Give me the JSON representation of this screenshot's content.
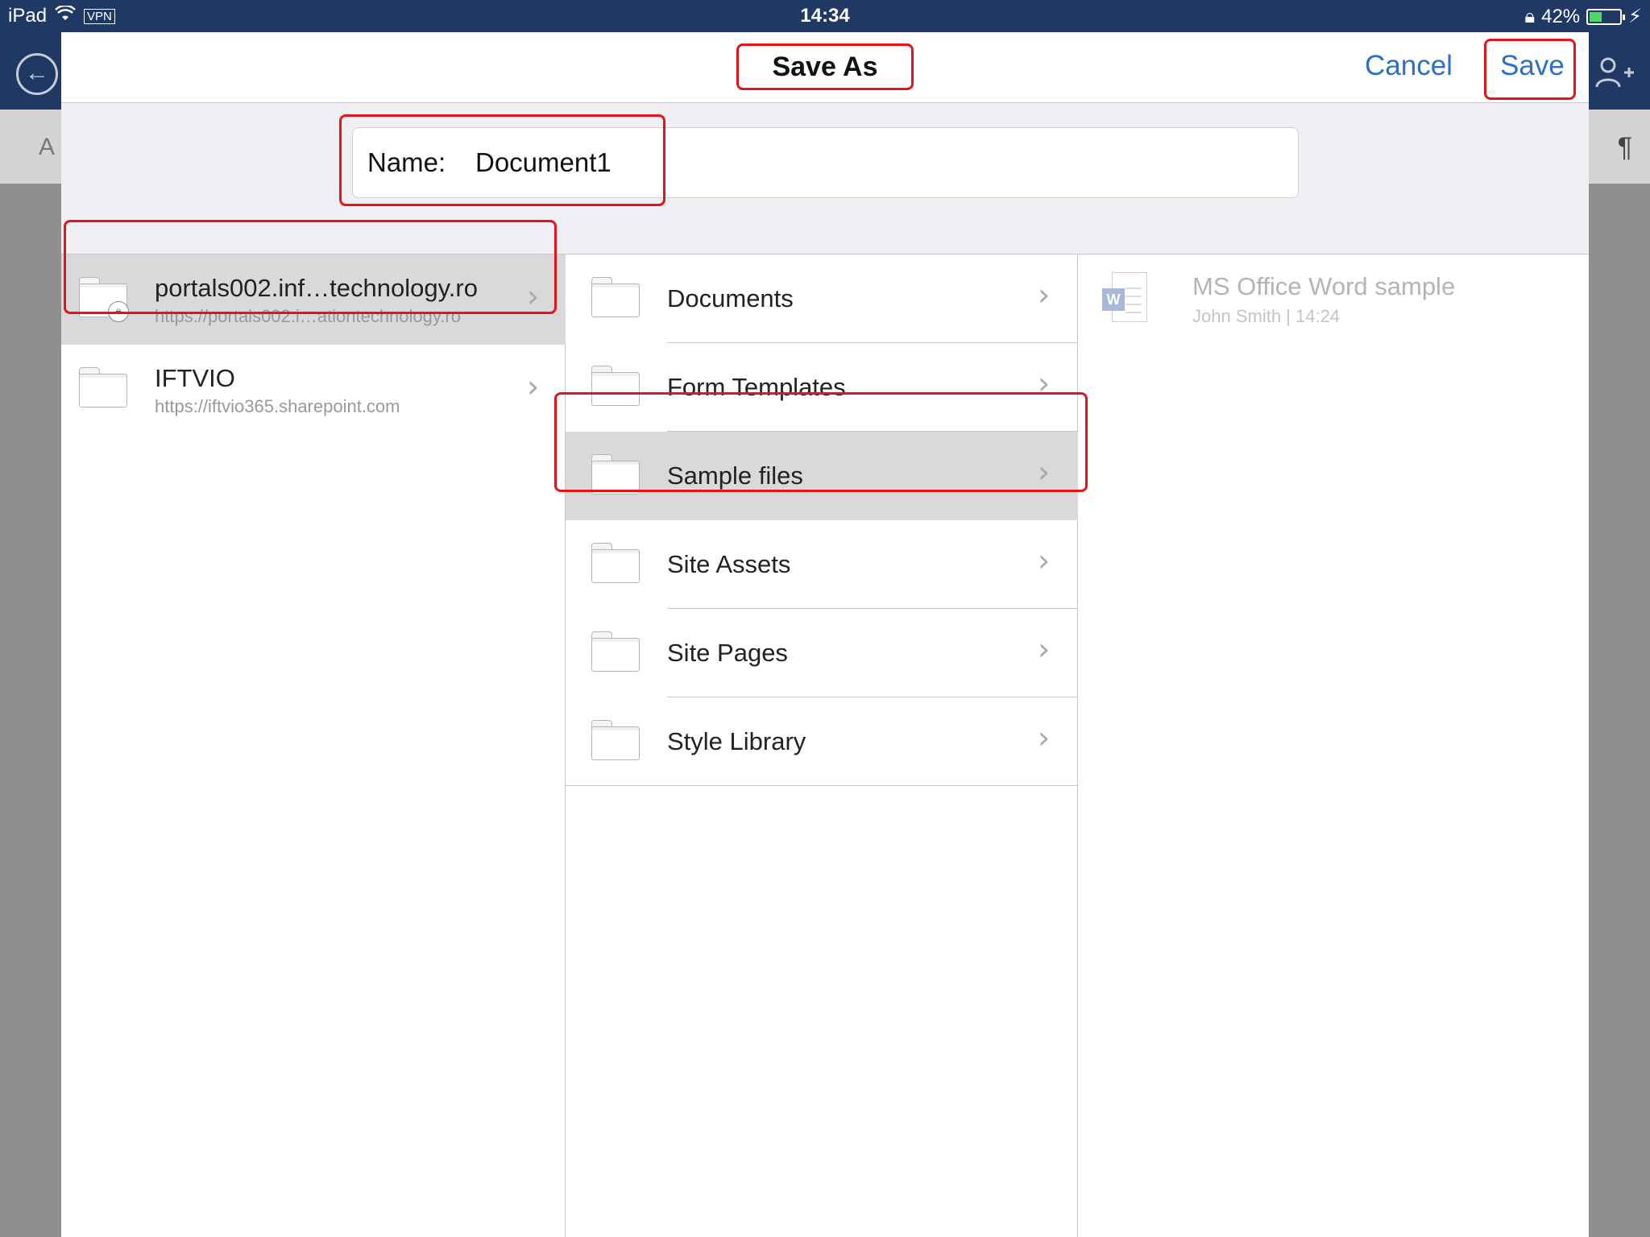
{
  "status_bar": {
    "device": "iPad",
    "vpn": "VPN",
    "time": "14:34",
    "battery": "42%",
    "battery_level": 0.42
  },
  "background_app": {
    "ribbon_font_glyph": "A",
    "ribbon_paragraph_glyph": "¶",
    "back_icon": "back-arrow-icon",
    "share_icon": "add-person-icon"
  },
  "dialog": {
    "title": "Save As",
    "cancel_label": "Cancel",
    "save_label": "Save",
    "name_label": "Name:",
    "name_value": "Document1"
  },
  "locations": [
    {
      "title": "portals002.inf…technology.ro",
      "url": "https://portals002.i…ationtechnology.ro",
      "selected": true,
      "locked": true
    },
    {
      "title": "IFTVIO",
      "url": "https://iftvio365.sharepoint.com",
      "selected": false,
      "locked": false
    }
  ],
  "folders": [
    {
      "label": "Documents",
      "selected": false
    },
    {
      "label": "Form Templates",
      "selected": false
    },
    {
      "label": "Sample files",
      "selected": true
    },
    {
      "label": "Site Assets",
      "selected": false
    },
    {
      "label": "Site Pages",
      "selected": false
    },
    {
      "label": "Style Library",
      "selected": false
    }
  ],
  "files": [
    {
      "name": "MS Office Word sample",
      "meta": "John Smith | 14:24",
      "icon": "word-document-icon"
    }
  ],
  "colors": {
    "app_bar": "#1f3864",
    "link_blue": "#2b6fc9",
    "annotation_red": "#e3141c",
    "selected_row": "#d9d9d9"
  }
}
